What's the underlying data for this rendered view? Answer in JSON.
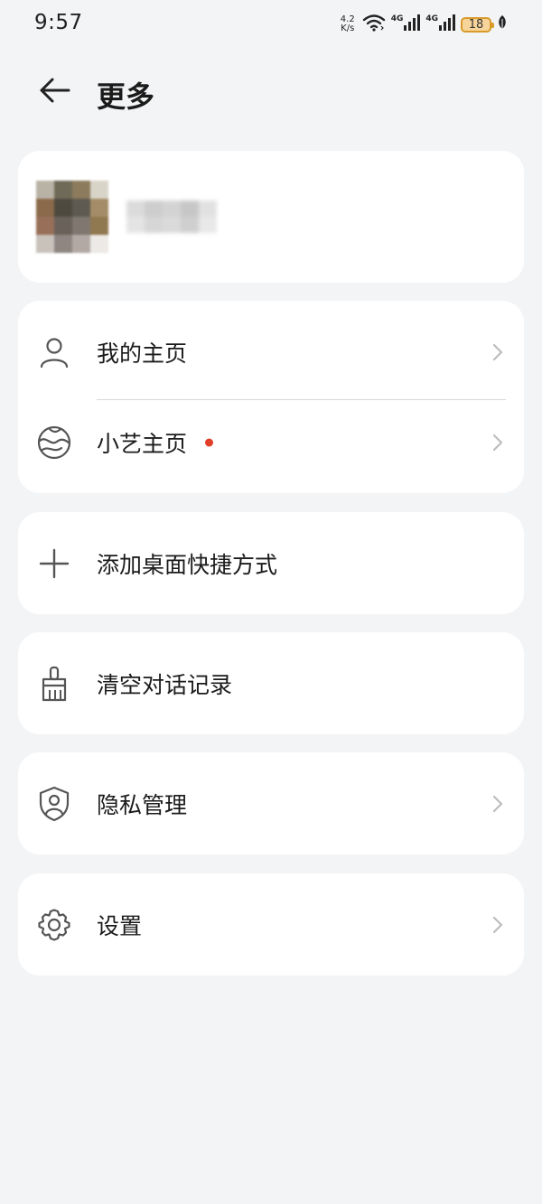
{
  "status_bar": {
    "time": "9:57",
    "net_speed_value": "4.2",
    "net_speed_unit": "K/s",
    "signal1_label": "4G",
    "signal2_label": "4G",
    "battery_level": "18"
  },
  "header": {
    "title": "更多"
  },
  "menu": {
    "my_homepage": "我的主页",
    "xiaoyi_homepage": "小艺主页",
    "add_shortcut": "添加桌面快捷方式",
    "clear_history": "清空对话记录",
    "privacy": "隐私管理",
    "settings": "设置"
  },
  "colors": {
    "background": "#f3f4f6",
    "card": "#ffffff",
    "badge_dot": "#e0402a",
    "battery": "#d99a2b"
  }
}
